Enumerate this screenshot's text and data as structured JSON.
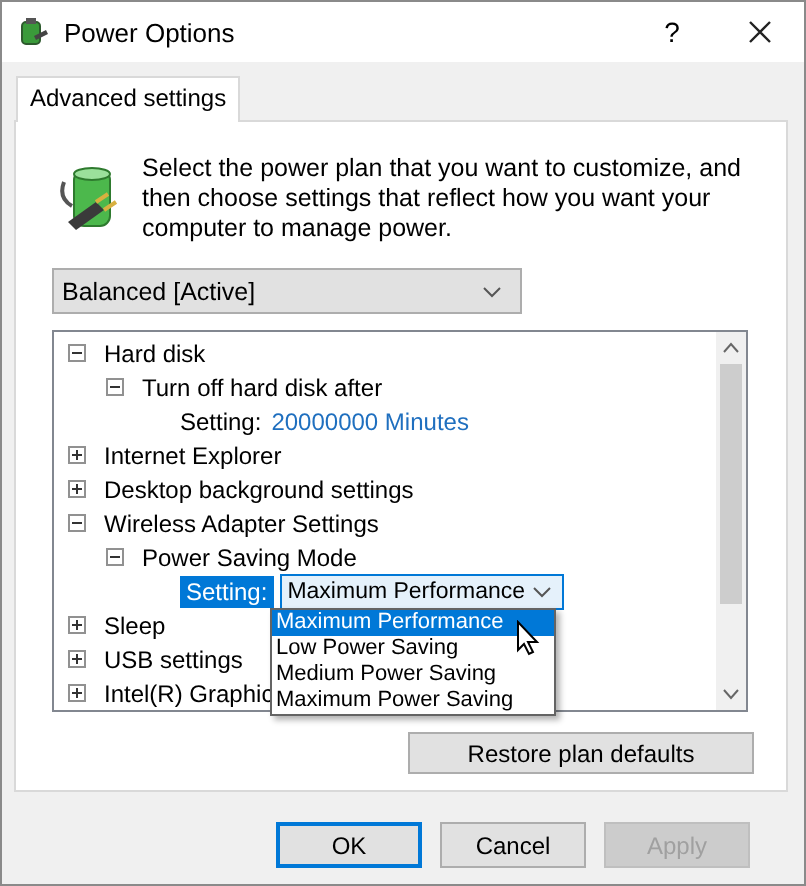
{
  "window": {
    "title": "Power Options",
    "help": "?"
  },
  "tabs": [
    {
      "label": "Advanced settings",
      "selected": true
    }
  ],
  "description": "Select the power plan that you want to customize, and then choose settings that reflect how you want your computer to manage power.",
  "plan_select": {
    "value": "Balanced [Active]"
  },
  "tree": [
    {
      "kind": "group",
      "label": "Hard disk",
      "expanded": true,
      "children": [
        {
          "kind": "group",
          "label": "Turn off hard disk after",
          "expanded": true,
          "children": [
            {
              "kind": "value",
              "label": "Setting:",
              "value": "20000000 Minutes"
            }
          ]
        }
      ]
    },
    {
      "kind": "group",
      "label": "Internet Explorer",
      "expanded": false
    },
    {
      "kind": "group",
      "label": "Desktop background settings",
      "expanded": false
    },
    {
      "kind": "group",
      "label": "Wireless Adapter Settings",
      "expanded": true,
      "children": [
        {
          "kind": "group",
          "label": "Power Saving Mode",
          "expanded": true,
          "children": [
            {
              "kind": "select",
              "label": "Setting:",
              "selected": true,
              "value": "Maximum Performance",
              "options": [
                {
                  "label": "Maximum Performance",
                  "selected": true
                },
                {
                  "label": "Low Power Saving",
                  "selected": false
                },
                {
                  "label": "Medium Power Saving",
                  "selected": false
                },
                {
                  "label": "Maximum Power Saving",
                  "selected": false
                }
              ]
            }
          ]
        }
      ]
    },
    {
      "kind": "group",
      "label": "Sleep",
      "expanded": false
    },
    {
      "kind": "group",
      "label": "USB settings",
      "expanded": false
    },
    {
      "kind": "group",
      "label": "Intel(R) Graphic",
      "expanded": false
    }
  ],
  "restore_button": "Restore plan defaults",
  "buttons": [
    {
      "label": "OK",
      "default": true,
      "disabled": false
    },
    {
      "label": "Cancel",
      "default": false,
      "disabled": false
    },
    {
      "label": "Apply",
      "default": false,
      "disabled": true
    }
  ]
}
